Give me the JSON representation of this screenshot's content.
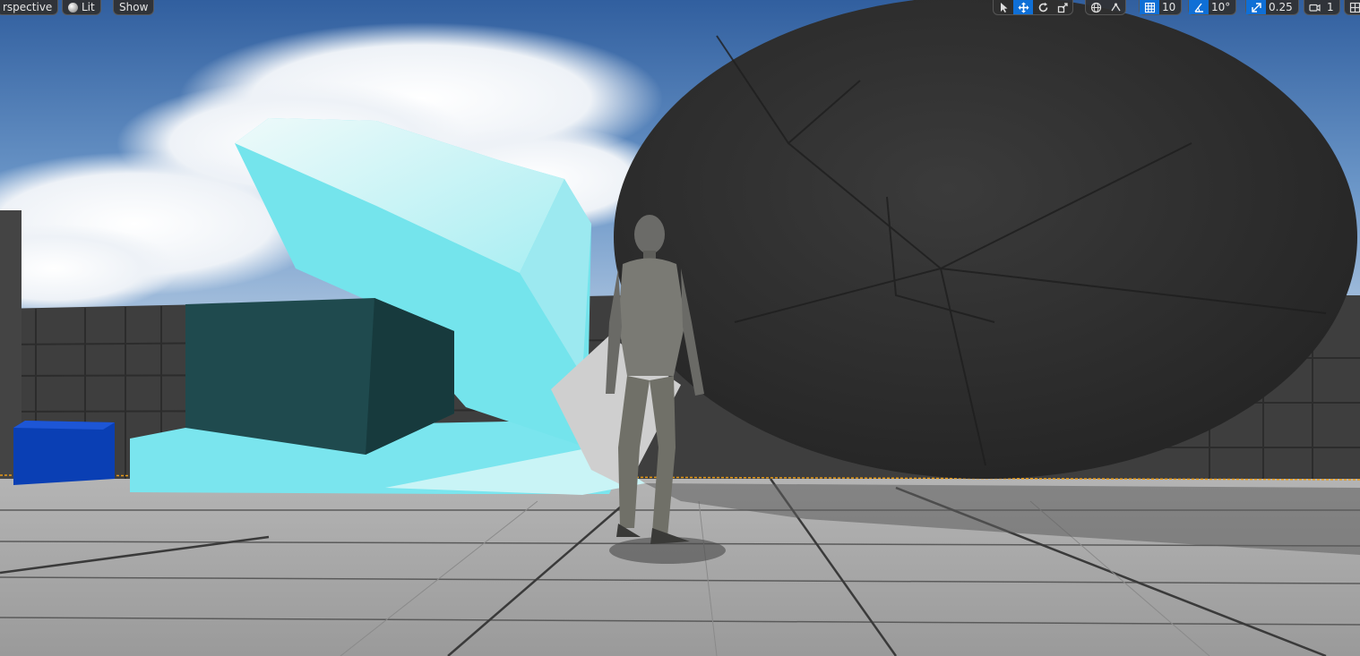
{
  "viewport_toolbar_left": {
    "view_mode": "rspective",
    "lighting_mode": "Lit",
    "show_menu": "Show"
  },
  "viewport_toolbar_right": {
    "grid_snap_value": "10",
    "rotation_snap_value": "10°",
    "scale_snap_value": "0.25",
    "camera_speed_value": "1"
  },
  "icons": [
    "select-icon",
    "translate-icon",
    "rotate-icon",
    "scale-icon",
    "world-space-icon",
    "surface-snap-icon",
    "grid-snap-icon",
    "rotation-snap-icon",
    "scale-snap-icon",
    "camera-speed-icon",
    "layout-icon"
  ],
  "colors": {
    "accent": "#0f6fd6",
    "ice": "#7ee6ee",
    "sky": "#4a7bb8",
    "floor": "#9b9b9b"
  }
}
